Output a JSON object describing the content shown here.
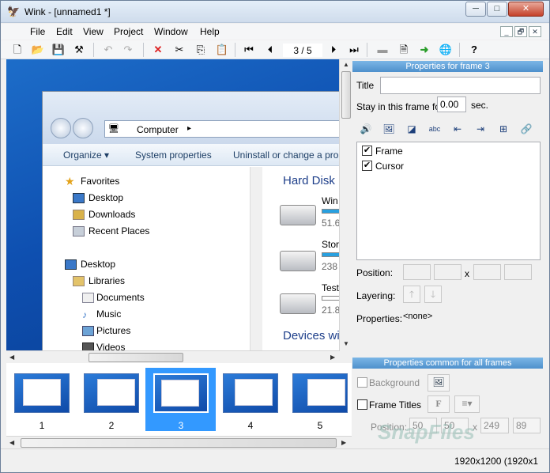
{
  "window": {
    "title": "Wink - [unnamed1 *]",
    "minimize": "─",
    "maximize": "□",
    "close": "✕"
  },
  "menu": {
    "items": [
      "File",
      "Edit",
      "View",
      "Project",
      "Window",
      "Help"
    ],
    "mdi": [
      "_",
      "🗗",
      "✕"
    ]
  },
  "toolbar": {
    "frame_counter": "3 / 5"
  },
  "screenshot": {
    "address": "Computer",
    "commands": [
      "Organize ▾",
      "System properties",
      "Uninstall or change a pro"
    ],
    "nav": {
      "favorites": "Favorites",
      "desktop": "Desktop",
      "downloads": "Downloads",
      "recent": "Recent Places",
      "desktop2": "Desktop",
      "libraries": "Libraries",
      "documents": "Documents",
      "music": "Music",
      "pictures": "Pictures",
      "videos": "Videos"
    },
    "content": {
      "hard_disk": "Hard Disk",
      "drives": [
        {
          "name": "Win",
          "size": "51.6"
        },
        {
          "name": "Stor",
          "size": "238"
        },
        {
          "name": "Test",
          "size": "21.8"
        }
      ],
      "devices": "Devices wi"
    }
  },
  "props_frame": {
    "header": "Properties for frame 3",
    "title_label": "Title",
    "title_value": "",
    "stay_label": "Stay in this frame for",
    "stay_value": "0.00",
    "stay_unit": "sec.",
    "list_items": [
      "Frame",
      "Cursor"
    ],
    "position_label": "Position:",
    "x_label": "x",
    "layering_label": "Layering:",
    "properties_label": "Properties:",
    "properties_value": "<none>"
  },
  "props_common": {
    "header": "Properties common for all frames",
    "background": "Background",
    "frame_titles": "Frame Titles",
    "font_btn": "F",
    "position_label": "Position:",
    "x_label": "x",
    "pos_values": [
      "50",
      "50",
      "249",
      "89"
    ]
  },
  "thumbnails": {
    "numbers": [
      "1",
      "2",
      "3",
      "4",
      "5"
    ],
    "selected": 3
  },
  "statusbar": {
    "resolution": "1920x1200 (1920x1"
  },
  "watermark": "SnapFiles"
}
